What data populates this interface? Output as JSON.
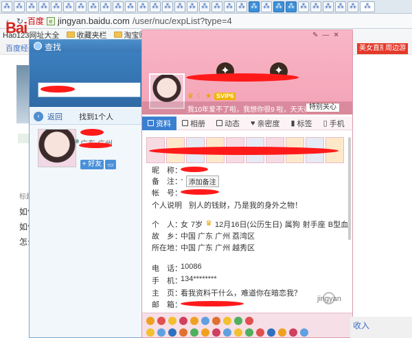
{
  "browser": {
    "url_host": "jingyan.baidu.com",
    "url_path": "/user/nuc/expList?type=4",
    "engine_label": "百度",
    "bookmarks": [
      "Hao123网址大全",
      "收藏夹栏",
      "淘宝购物"
    ]
  },
  "page": {
    "logo_red": "Bai",
    "subnav": "百度经验",
    "lines": [
      "标题",
      "如何",
      "如何",
      "怎么"
    ],
    "right_btn1": "美女直播",
    "right_btn2": "周边游",
    "bottom_right": "收入",
    "watermark": "jingyan"
  },
  "search_window": {
    "title": "查找",
    "back_label": "返回",
    "found_label": "找到1个人",
    "location": "广东 广州",
    "friend_button": "+ 好友"
  },
  "profile_window": {
    "signature": "我10年爱不了啦，我想你很9 啦，天天都想见...",
    "follow_button": "特别关心",
    "vip_label": "SVIP6",
    "tabs": [
      "资料",
      "相册",
      "动态",
      "亲密度",
      "标签",
      "手机"
    ],
    "info": {
      "nickname_label": "昵　称：",
      "remark_label": "备　注：",
      "remark_value": "-",
      "add_remark": "添加备注",
      "account_label": "帐　号：",
      "personal_desc_label": "个人说明",
      "personal_desc": "别人的钱财，乃是我的身外之物！",
      "person_label": "个　人：",
      "gender": "女",
      "age": "7岁",
      "birthday": "12月16日(公历生日)",
      "zodiac": "属狗",
      "sign": "射手座",
      "blood": "B型血",
      "hometown_label": "故　乡：",
      "hometown": "中国 广东 广州 荔湾区",
      "location_label": "所在地：",
      "location": "中国 广东 广州 越秀区",
      "phone_label": "电　话：",
      "phone": "10086",
      "mobile_label": "手　机：",
      "mobile": "134********",
      "homepage_label": "主　页：",
      "homepage": "看我资料干什么，难道你在暗恋我？",
      "email_label": "邮　箱："
    }
  }
}
